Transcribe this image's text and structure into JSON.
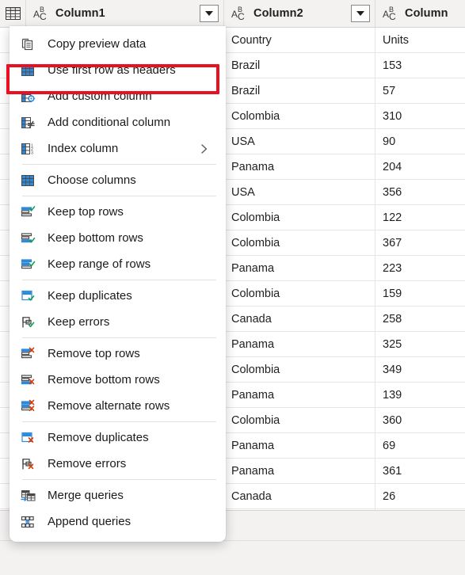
{
  "grid": {
    "corner_icon": "table-icon",
    "type_icon": "abc-text-type-icon",
    "columns": [
      {
        "name": "Column1",
        "has_dropdown": true
      },
      {
        "name": "Column2",
        "has_dropdown": true
      },
      {
        "name": "Column",
        "has_dropdown": false
      }
    ],
    "rows": [
      {
        "c2": "Country",
        "c3": "Units"
      },
      {
        "c2": "Brazil",
        "c3": "153"
      },
      {
        "c2": "Brazil",
        "c3": "57"
      },
      {
        "c2": "Colombia",
        "c3": "310"
      },
      {
        "c2": "USA",
        "c3": "90"
      },
      {
        "c2": "Panama",
        "c3": "204"
      },
      {
        "c2": "USA",
        "c3": "356"
      },
      {
        "c2": "Colombia",
        "c3": "122"
      },
      {
        "c2": "Colombia",
        "c3": "367"
      },
      {
        "c2": "Panama",
        "c3": "223"
      },
      {
        "c2": "Colombia",
        "c3": "159"
      },
      {
        "c2": "Canada",
        "c3": "258"
      },
      {
        "c2": "Panama",
        "c3": "325"
      },
      {
        "c2": "Colombia",
        "c3": "349"
      },
      {
        "c2": "Panama",
        "c3": "139"
      },
      {
        "c2": "Colombia",
        "c3": "360"
      },
      {
        "c2": "Panama",
        "c3": "69"
      },
      {
        "c2": "Panama",
        "c3": "361"
      },
      {
        "c2": "Canada",
        "c3": "26"
      },
      {
        "c2": "",
        "c3": ""
      }
    ]
  },
  "menu": {
    "highlighted_item": "Use first row as headers",
    "highlight_color": "#e81123",
    "items": [
      {
        "label": "Copy preview data",
        "icon": "copy-icon",
        "submenu": false,
        "separator_after": false
      },
      {
        "label": "Use first row as headers",
        "icon": "use-first-row-headers-icon",
        "submenu": false,
        "separator_after": false
      },
      {
        "label": "Add custom column",
        "icon": "add-custom-column-icon",
        "submenu": false,
        "separator_after": false
      },
      {
        "label": "Add conditional column",
        "icon": "add-conditional-column-icon",
        "submenu": false,
        "separator_after": false
      },
      {
        "label": "Index column",
        "icon": "index-column-icon",
        "submenu": true,
        "separator_after": true
      },
      {
        "label": "Choose columns",
        "icon": "choose-columns-icon",
        "submenu": false,
        "separator_after": true
      },
      {
        "label": "Keep top rows",
        "icon": "keep-top-rows-icon",
        "submenu": false,
        "separator_after": false
      },
      {
        "label": "Keep bottom rows",
        "icon": "keep-bottom-rows-icon",
        "submenu": false,
        "separator_after": false
      },
      {
        "label": "Keep range of rows",
        "icon": "keep-range-of-rows-icon",
        "submenu": false,
        "separator_after": true
      },
      {
        "label": "Keep duplicates",
        "icon": "keep-duplicates-icon",
        "submenu": false,
        "separator_after": false
      },
      {
        "label": "Keep errors",
        "icon": "keep-errors-icon",
        "submenu": false,
        "separator_after": true
      },
      {
        "label": "Remove top rows",
        "icon": "remove-top-rows-icon",
        "submenu": false,
        "separator_after": false
      },
      {
        "label": "Remove bottom rows",
        "icon": "remove-bottom-rows-icon",
        "submenu": false,
        "separator_after": false
      },
      {
        "label": "Remove alternate rows",
        "icon": "remove-alternate-rows-icon",
        "submenu": false,
        "separator_after": true
      },
      {
        "label": "Remove duplicates",
        "icon": "remove-duplicates-icon",
        "submenu": false,
        "separator_after": false
      },
      {
        "label": "Remove errors",
        "icon": "remove-errors-icon",
        "submenu": false,
        "separator_after": true
      },
      {
        "label": "Merge queries",
        "icon": "merge-queries-icon",
        "submenu": false,
        "separator_after": false
      },
      {
        "label": "Append queries",
        "icon": "append-queries-icon",
        "submenu": false,
        "separator_after": false
      }
    ]
  },
  "colors": {
    "accent_blue": "#2e8ad8",
    "icon_dark": "#4a4a4a",
    "check_green": "#0f9d58",
    "error_red": "#d83b01",
    "header_bg": "#f3f2f1",
    "highlight_red": "#e81123"
  }
}
